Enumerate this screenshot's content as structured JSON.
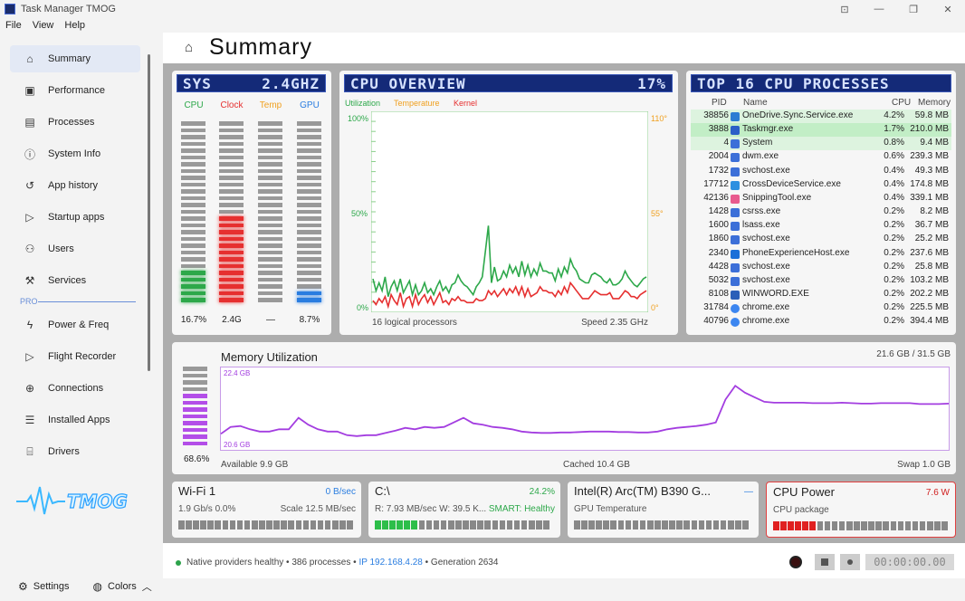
{
  "window": {
    "title": "Task Manager TMOG"
  },
  "menu": [
    "File",
    "View",
    "Help"
  ],
  "sidebar": {
    "items": [
      {
        "label": "Summary",
        "icon": "home-icon"
      },
      {
        "label": "Performance",
        "icon": "performance-icon"
      },
      {
        "label": "Processes",
        "icon": "processes-icon"
      },
      {
        "label": "System Info",
        "icon": "info-icon"
      },
      {
        "label": "App history",
        "icon": "history-icon"
      },
      {
        "label": "Startup apps",
        "icon": "play-icon"
      },
      {
        "label": "Users",
        "icon": "users-icon"
      },
      {
        "label": "Services",
        "icon": "services-icon"
      },
      {
        "label": "Power & Freq",
        "icon": "power-icon"
      },
      {
        "label": "Flight Recorder",
        "icon": "recorder-icon"
      },
      {
        "label": "Connections",
        "icon": "globe-icon"
      },
      {
        "label": "Installed Apps",
        "icon": "list-icon"
      },
      {
        "label": "Drivers",
        "icon": "drivers-icon"
      }
    ],
    "pro_label": "PRO",
    "logo_text": "TMOG",
    "settings_label": "Settings",
    "colors_label": "Colors"
  },
  "header": {
    "title": "Summary"
  },
  "sys": {
    "lcd_left": "SYS",
    "lcd_right": "2.4GHZ",
    "columns": [
      {
        "label": "CPU",
        "color": "#2da84a",
        "level": 0.167,
        "value": "16.7%"
      },
      {
        "label": "Clock",
        "color": "#e63030",
        "level": 0.48,
        "value": "2.4G"
      },
      {
        "label": "Temp",
        "color": "#f0a020",
        "level": 0.0,
        "value": "—"
      },
      {
        "label": "GPU",
        "color": "#2a7de0",
        "level": 0.087,
        "value": "8.7%"
      }
    ]
  },
  "cpu": {
    "lcd_left": "CPU OVERVIEW",
    "lcd_right": "17%",
    "legend": [
      "Utilization",
      "Temperature",
      "Kernel"
    ],
    "y_left": [
      "100%",
      "50%",
      "0%"
    ],
    "y_right": [
      "110°",
      "55°",
      "0°"
    ],
    "footer_left": "16 logical processors",
    "footer_right": "Speed 2.35 GHz"
  },
  "top": {
    "lcd_left": "TOP 16 CPU PROCESSES",
    "headers": {
      "pid": "PID",
      "name": "Name",
      "cpu": "CPU",
      "mem": "Memory"
    },
    "rows": [
      {
        "pid": "38856",
        "name": "OneDrive.Sync.Service.exe",
        "cpu": "4.2%",
        "mem": "59.8 MB",
        "icon": "onedrive-icon",
        "hl": true
      },
      {
        "pid": "3888",
        "name": "Taskmgr.exe",
        "cpu": "1.7%",
        "mem": "210.0 MB",
        "icon": "taskmgr-icon",
        "hl": true,
        "strong": true
      },
      {
        "pid": "4",
        "name": "System",
        "cpu": "0.8%",
        "mem": "9.4 MB",
        "icon": "app-icon",
        "hl": true
      },
      {
        "pid": "2004",
        "name": "dwm.exe",
        "cpu": "0.6%",
        "mem": "239.3 MB",
        "icon": "app-icon"
      },
      {
        "pid": "1732",
        "name": "svchost.exe",
        "cpu": "0.4%",
        "mem": "49.3 MB",
        "icon": "app-icon"
      },
      {
        "pid": "17712",
        "name": "CrossDeviceService.exe",
        "cpu": "0.4%",
        "mem": "174.8 MB",
        "icon": "crossdevice-icon"
      },
      {
        "pid": "42136",
        "name": "SnippingTool.exe",
        "cpu": "0.4%",
        "mem": "339.1 MB",
        "icon": "snipping-icon"
      },
      {
        "pid": "1428",
        "name": "csrss.exe",
        "cpu": "0.2%",
        "mem": "8.2 MB",
        "icon": "app-icon"
      },
      {
        "pid": "1600",
        "name": "lsass.exe",
        "cpu": "0.2%",
        "mem": "36.7 MB",
        "icon": "app-icon"
      },
      {
        "pid": "1860",
        "name": "svchost.exe",
        "cpu": "0.2%",
        "mem": "25.2 MB",
        "icon": "app-icon"
      },
      {
        "pid": "2340",
        "name": "PhoneExperienceHost.exe",
        "cpu": "0.2%",
        "mem": "237.6 MB",
        "icon": "phone-icon"
      },
      {
        "pid": "4428",
        "name": "svchost.exe",
        "cpu": "0.2%",
        "mem": "25.8 MB",
        "icon": "app-icon"
      },
      {
        "pid": "5032",
        "name": "svchost.exe",
        "cpu": "0.2%",
        "mem": "103.2 MB",
        "icon": "app-icon"
      },
      {
        "pid": "8108",
        "name": "WINWORD.EXE",
        "cpu": "0.2%",
        "mem": "202.2 MB",
        "icon": "word-icon"
      },
      {
        "pid": "31784",
        "name": "chrome.exe",
        "cpu": "0.2%",
        "mem": "225.5 MB",
        "icon": "chrome-icon"
      },
      {
        "pid": "40796",
        "name": "chrome.exe",
        "cpu": "0.2%",
        "mem": "394.4 MB",
        "icon": "chrome-icon"
      }
    ]
  },
  "memory": {
    "title": "Memory Utilization",
    "total": "21.6 GB / 31.5 GB",
    "percent": "68.6%",
    "level": 0.686,
    "top_label": "22.4 GB",
    "bottom_label": "20.6 GB",
    "available": "Available 9.9 GB",
    "cached": "Cached 10.4 GB",
    "swap": "Swap 1.0 GB"
  },
  "cards": [
    {
      "title": "Wi-Fi 1",
      "right": "0 B/sec",
      "right_color": "#2a7de0",
      "l2": "1.9 Gb/s  0.0%",
      "r2": "Scale 12.5 MB/sec",
      "fill": 0,
      "fill_color": "#888"
    },
    {
      "title": "C:\\",
      "right": "24.2%",
      "right_color": "#2da84a",
      "l2": "R: 7.93 MB/sec  W: 39.5 K...",
      "r2": "SMART: Healthy",
      "r2_color": "#2da84a",
      "fill": 0.242,
      "fill_color": "#2dbe4a"
    },
    {
      "title": "Intel(R) Arc(TM) B390 G...",
      "right": "—",
      "right_color": "#2a7de0",
      "l2": "GPU Temperature",
      "r2": "",
      "fill": 0,
      "fill_color": "#888"
    },
    {
      "title": "CPU Power",
      "right": "7.6 W",
      "right_color": "#d02020",
      "l2": "CPU package",
      "r2": "",
      "fill": 0.25,
      "fill_color": "#e02020",
      "alert": true
    }
  ],
  "status": {
    "text": "Native providers healthy  •  386 processes  •  ",
    "ip": "IP 192.168.4.28",
    "gen": "  •  Generation 2634",
    "timer": "00:00:00.00"
  },
  "chart_data": [
    {
      "type": "line",
      "title": "CPU OVERVIEW",
      "ylim": [
        0,
        100
      ],
      "ylim_right": [
        0,
        110
      ],
      "series": [
        {
          "name": "Utilization",
          "color": "#2da84a",
          "values": [
            16,
            10,
            14,
            10,
            17,
            7,
            12,
            15,
            10,
            16,
            9,
            12,
            15,
            8,
            13,
            8,
            10,
            14,
            9,
            11,
            8,
            12,
            15,
            10,
            12,
            9,
            13,
            14,
            18,
            15,
            13,
            12,
            10,
            8,
            12,
            14,
            17,
            30,
            43,
            14,
            22,
            15,
            16,
            20,
            17,
            23,
            19,
            22,
            17,
            25,
            18,
            23,
            17,
            21,
            18,
            24,
            20,
            20,
            19,
            19,
            15,
            21,
            17,
            22,
            19,
            26,
            22,
            20,
            16,
            15,
            14,
            14,
            18,
            19,
            18,
            17,
            15,
            14,
            16,
            13,
            13,
            14,
            16,
            20,
            17,
            15,
            13,
            12,
            14,
            16,
            17
          ]
        },
        {
          "name": "Kernel",
          "color": "#e63030",
          "values": [
            5,
            3,
            6,
            4,
            7,
            2,
            8,
            5,
            3,
            9,
            2,
            6,
            7,
            2,
            8,
            3,
            6,
            8,
            4,
            7,
            3,
            6,
            9,
            4,
            5,
            3,
            6,
            5,
            7,
            5,
            5,
            4,
            4,
            4,
            6,
            5,
            5,
            6,
            10,
            8,
            10,
            7,
            9,
            11,
            8,
            11,
            9,
            12,
            8,
            12,
            7,
            11,
            7,
            8,
            9,
            12,
            10,
            10,
            9,
            9,
            7,
            10,
            8,
            12,
            9,
            14,
            12,
            10,
            8,
            6,
            6,
            6,
            8,
            10,
            9,
            8,
            8,
            8,
            9,
            6,
            6,
            6,
            8,
            10,
            9,
            7,
            7,
            6,
            8,
            9,
            10
          ]
        }
      ]
    },
    {
      "type": "line",
      "title": "Memory Utilization",
      "ylim": [
        20.6,
        22.4
      ],
      "series": [
        {
          "name": "Memory",
          "color": "#a33de0",
          "values": [
            20.95,
            21.1,
            21.12,
            21.05,
            21.0,
            21.0,
            21.05,
            21.05,
            21.3,
            21.15,
            21.05,
            21.0,
            21.0,
            20.92,
            20.9,
            20.92,
            20.92,
            20.97,
            21.02,
            21.08,
            21.05,
            21.1,
            21.08,
            21.1,
            21.2,
            21.3,
            21.18,
            21.15,
            21.1,
            21.08,
            21.05,
            21.0,
            20.98,
            20.97,
            20.97,
            20.98,
            20.98,
            20.99,
            21.0,
            21.0,
            21.0,
            20.99,
            20.99,
            20.98,
            20.98,
            21.0,
            21.05,
            21.08,
            21.1,
            21.12,
            21.15,
            21.2,
            21.7,
            22.0,
            21.85,
            21.75,
            21.65,
            21.63,
            21.63,
            21.63,
            21.63,
            21.62,
            21.62,
            21.62,
            21.63,
            21.62,
            21.61,
            21.61,
            21.62,
            21.62,
            21.62,
            21.62,
            21.6,
            21.6,
            21.6,
            21.61
          ]
        }
      ]
    }
  ]
}
